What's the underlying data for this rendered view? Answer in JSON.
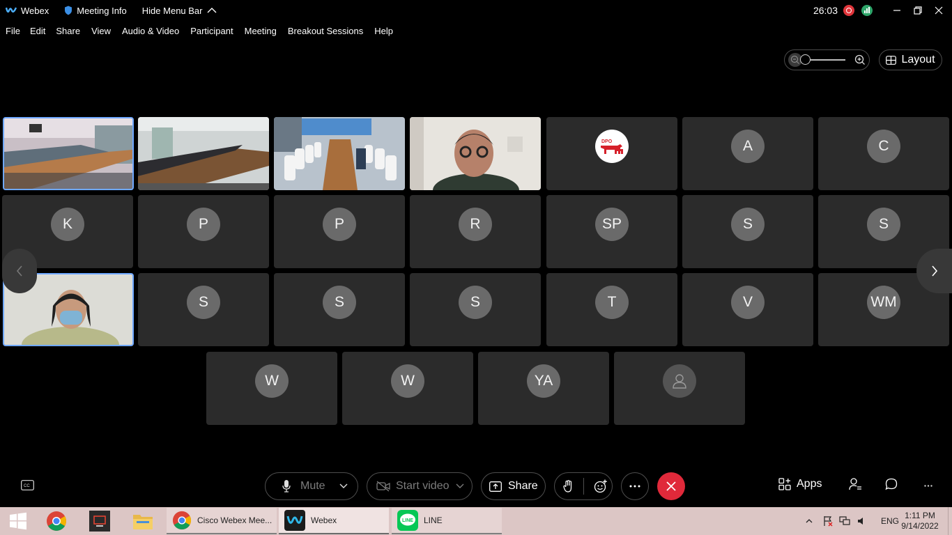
{
  "titlebar": {
    "app_name": "Webex",
    "meeting_info": "Meeting Info",
    "hide_menu_bar": "Hide Menu Bar",
    "timer": "26:03"
  },
  "menu": [
    "File",
    "Edit",
    "Share",
    "View",
    "Audio & Video",
    "Participant",
    "Meeting",
    "Breakout Sessions",
    "Help"
  ],
  "layout_label": "Layout",
  "tiles": {
    "row1": [
      {
        "type": "video",
        "scene": "meeting room with long table",
        "active": true
      },
      {
        "type": "video",
        "scene": "empty conference room"
      },
      {
        "type": "video",
        "scene": "conference room with white chairs"
      },
      {
        "type": "video",
        "scene": "man with glasses"
      },
      {
        "type": "logo",
        "text": "DPO"
      },
      {
        "type": "initial",
        "text": "A"
      },
      {
        "type": "initial",
        "text": "C"
      }
    ],
    "row2": [
      {
        "type": "initial",
        "text": "K"
      },
      {
        "type": "initial",
        "text": "P"
      },
      {
        "type": "initial",
        "text": "P"
      },
      {
        "type": "initial",
        "text": "R"
      },
      {
        "type": "initial",
        "text": "SP"
      },
      {
        "type": "initial",
        "text": "S"
      },
      {
        "type": "initial",
        "text": "S"
      }
    ],
    "row3": [
      {
        "type": "video",
        "scene": "woman with face mask",
        "active": true
      },
      {
        "type": "initial",
        "text": "S"
      },
      {
        "type": "initial",
        "text": "S"
      },
      {
        "type": "initial",
        "text": "S"
      },
      {
        "type": "initial",
        "text": "T"
      },
      {
        "type": "initial",
        "text": "V"
      },
      {
        "type": "initial",
        "text": "WM"
      }
    ],
    "row4": [
      {
        "type": "initial",
        "text": "W"
      },
      {
        "type": "initial",
        "text": "W"
      },
      {
        "type": "initial",
        "text": "YA"
      },
      {
        "type": "person-icon",
        "text": ""
      }
    ]
  },
  "controls": {
    "mute": "Mute",
    "start_video": "Start video",
    "share": "Share",
    "apps": "Apps"
  },
  "taskbar": {
    "apps": [
      {
        "label": "Cisco Webex Mee...",
        "icon": "chrome-icon"
      },
      {
        "label": "Webex",
        "icon": "webex-icon"
      },
      {
        "label": "LINE",
        "icon": "line-icon"
      }
    ],
    "lang": "ENG",
    "time": "1:11 PM",
    "date": "9/14/2022"
  },
  "colors": {
    "accent_blue": "#6fa8ff",
    "end_red": "#e0293a",
    "record_red": "#e0353b",
    "signal_green": "#2fa56a",
    "taskbar": "#dcc6c5"
  }
}
